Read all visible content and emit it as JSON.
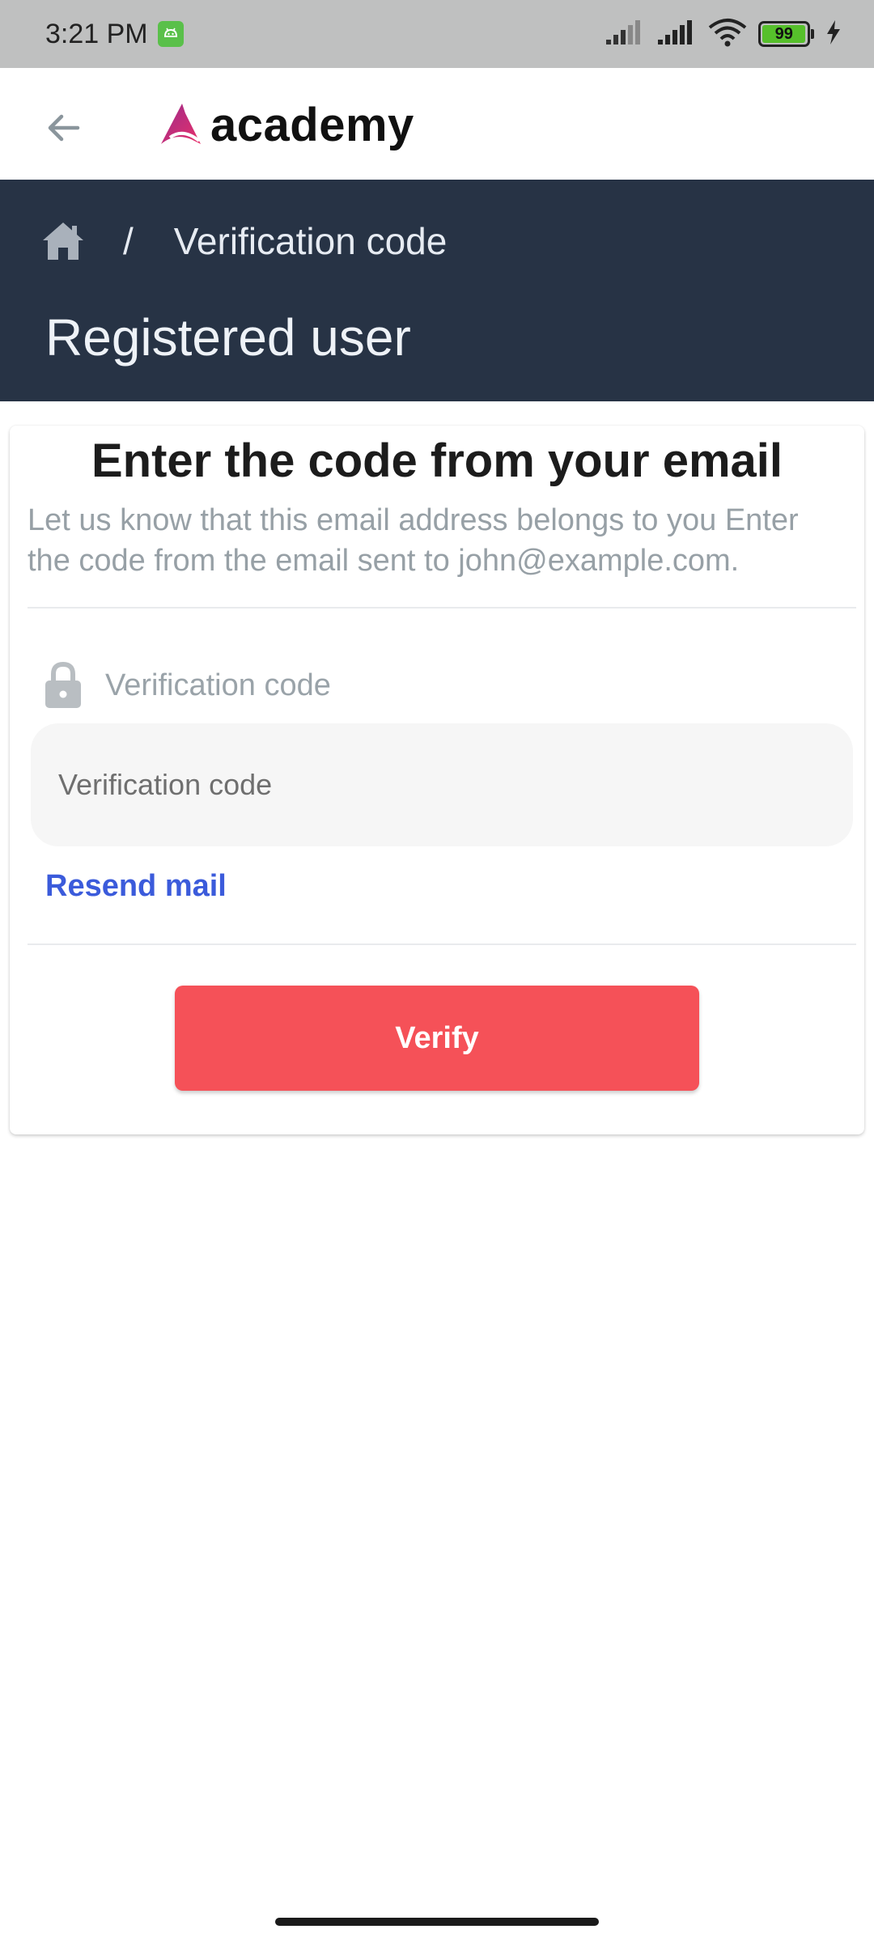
{
  "status_bar": {
    "time": "3:21 PM",
    "battery_level": "99",
    "battery_fraction": 0.99,
    "icons": [
      "android-notification-icon",
      "signal-icon",
      "signal-icon",
      "wifi-icon",
      "battery-icon",
      "charging-icon"
    ]
  },
  "app_bar": {
    "back_icon": "arrow-left-icon",
    "logo_text": "academy"
  },
  "header": {
    "home_icon": "home-icon",
    "separator": "/",
    "breadcrumb_current": "Verification code",
    "title": "Registered user"
  },
  "card": {
    "heading": "Enter the code from your email",
    "description": "Let us know that this email address belongs to you Enter the code from the email sent to john@example.com.",
    "field_label": "Verification code",
    "field_icon": "lock-icon",
    "input_placeholder": "Verification code",
    "input_value": "",
    "resend_label": "Resend mail",
    "verify_label": "Verify"
  },
  "colors": {
    "status_bar_bg": "#bfc0c0",
    "header_bg": "#273345",
    "accent_link": "#3b5bdb",
    "verify_button": "#f55158",
    "logo_gradient_start": "#a3247d",
    "logo_gradient_end": "#e8316a"
  }
}
